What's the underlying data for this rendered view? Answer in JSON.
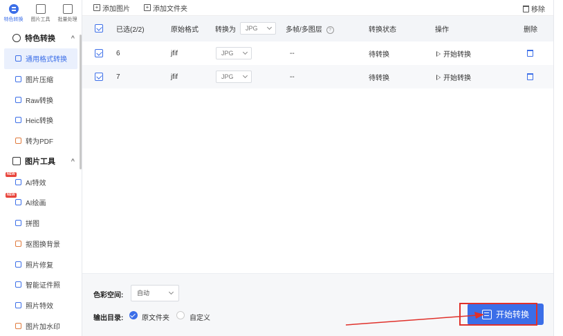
{
  "topnav": [
    {
      "label": "特色转换",
      "icon": "feature-convert-icon",
      "active": true
    },
    {
      "label": "图片工具",
      "icon": "image-tools-icon",
      "active": false
    },
    {
      "label": "批量处理",
      "icon": "batch-process-icon",
      "active": false
    }
  ],
  "sidebar": {
    "section1": {
      "title": "特色转换",
      "caret": "^"
    },
    "items1": [
      {
        "label": "通用格式转换",
        "active": true
      },
      {
        "label": "图片压缩"
      },
      {
        "label": "Raw转换"
      },
      {
        "label": "Heic转换"
      },
      {
        "label": "转为PDF"
      }
    ],
    "section2": {
      "title": "图片工具",
      "caret": "^"
    },
    "items2": [
      {
        "label": "AI特效",
        "badge": "NEW"
      },
      {
        "label": "AI绘画",
        "badge": "NEW"
      },
      {
        "label": "拼图"
      },
      {
        "label": "抠图换背景"
      },
      {
        "label": "照片修复"
      },
      {
        "label": "智能证件照"
      },
      {
        "label": "照片特效"
      },
      {
        "label": "图片加水印"
      }
    ]
  },
  "toolbar": {
    "add_image": "添加图片",
    "add_folder": "添加文件夹",
    "remove": "移除",
    "plus": "+"
  },
  "table": {
    "headers": {
      "selected": "已选(2/2)",
      "original_format": "原始格式",
      "convert_to": "转换为",
      "convert_to_value": "JPG",
      "multi_frame": "多帧/多图层",
      "help": "?",
      "status": "转换状态",
      "action": "操作",
      "delete": "删除"
    },
    "rows": [
      {
        "name": "6",
        "format": "jfif",
        "target": "JPG",
        "multi": "--",
        "status": "待转换",
        "action": "开始转换"
      },
      {
        "name": "7",
        "format": "jfif",
        "target": "JPG",
        "multi": "--",
        "status": "待转换",
        "action": "开始转换"
      }
    ]
  },
  "bottom": {
    "color_space_label": "色彩空间:",
    "color_space_value": "自动",
    "output_label": "输出目录:",
    "option_original": "原文件夹",
    "option_custom": "自定义",
    "start_button": "开始转换"
  },
  "colors": {
    "accent": "#3b6ee8",
    "highlight": "#e0302a"
  }
}
